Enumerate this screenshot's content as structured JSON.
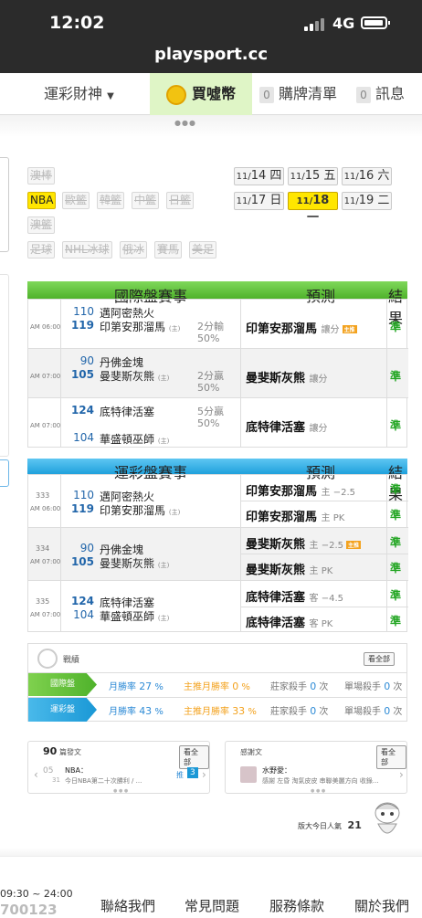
{
  "status": {
    "time": "12:02",
    "network": "4G"
  },
  "url": "playsport.cc",
  "nav": {
    "menu": "運彩財神",
    "buy": "買噓幣",
    "cart_count": "0",
    "cart": "購牌清單",
    "msg_count": "0",
    "msg": "訊息"
  },
  "sports": {
    "row1": [
      "澳棒"
    ],
    "row2": [
      "NBA",
      "歐籃",
      "韓籃",
      "中籃",
      "日籃"
    ],
    "row3": [
      "澳籃"
    ],
    "row4": [
      "足球",
      "NHL冰球",
      "俄冰",
      "賽馬",
      "美足"
    ]
  },
  "dates": [
    {
      "d": "11/",
      "n": "14",
      "w": "四"
    },
    {
      "d": "11/",
      "n": "15",
      "w": "五"
    },
    {
      "d": "11/",
      "n": "16",
      "w": "六"
    },
    {
      "d": "11/",
      "n": "17",
      "w": "日"
    },
    {
      "d": "11/",
      "n": "18",
      "w": "一"
    },
    {
      "d": "11/",
      "n": "19",
      "w": "二"
    }
  ],
  "intl": {
    "header": "國際盤賽事",
    "predict": "預測",
    "result": "結果",
    "games": [
      {
        "time": "AM 06:00",
        "n1": "110",
        "t1": "邁阿密熱火",
        "n2": "119",
        "t2": "印第安那溜馬",
        "home": "(主)",
        "line1": "2分輸",
        "line2": "50%",
        "pred": "印第安那溜馬",
        "ptype": "讓分",
        "res": "準"
      },
      {
        "time": "AM 07:00",
        "n1": "90",
        "t1": "丹佛金塊",
        "n2": "105",
        "t2": "曼斐斯灰熊",
        "home": "(主)",
        "line1": "2分贏",
        "line2": "50%",
        "pred": "曼斐斯灰熊",
        "ptype": "讓分",
        "res": "準"
      },
      {
        "time": "AM 07:00",
        "n1": "124",
        "t1": "底特律活塞",
        "n2": "104",
        "t2": "華盛頓巫師",
        "home": "(主)",
        "line1": "5分贏",
        "line2": "50%",
        "pred": "底特律活塞",
        "ptype": "讓分",
        "res": "準"
      }
    ]
  },
  "sportlottery": {
    "header": "運彩盤賽事",
    "predict": "預測",
    "result": "結果",
    "games": [
      {
        "no": "333",
        "time": "AM 06:00",
        "n1": "110",
        "t1": "邁阿密熱火",
        "n2": "119",
        "t2": "印第安那溜馬",
        "home": "(主)",
        "p1": "印第安那溜馬",
        "p1s": "主 −2.5",
        "p2": "印第安那溜馬",
        "p2s": "主 PK",
        "r1": "準",
        "r2": "準"
      },
      {
        "no": "334",
        "time": "AM 07:00",
        "n1": "90",
        "t1": "丹佛金塊",
        "n2": "105",
        "t2": "曼斐斯灰熊",
        "home": "(主)",
        "p1": "曼斐斯灰熊",
        "p1s": "主 −2.5",
        "p2": "曼斐斯灰熊",
        "p2s": "主 PK",
        "r1": "準",
        "r2": "準"
      },
      {
        "no": "335",
        "time": "AM 07:00",
        "n1": "124",
        "t1": "底特律活塞",
        "n2": "104",
        "t2": "華盛頓巫師",
        "home": "(主)",
        "p1": "底特律活塞",
        "p1s": "客 −4.5",
        "p2": "底特律活塞",
        "p2s": "客 PK",
        "r1": "準",
        "r2": "準"
      }
    ]
  },
  "record": {
    "title": "戰績",
    "all": "看全部",
    "rows": [
      {
        "label": "國際盤",
        "c1": "月勝率",
        "v1": "27",
        "c2": "主推月勝率",
        "v2": "0",
        "c3": "莊家殺手",
        "v3": "0",
        "c4": "單場殺手",
        "v4": "0"
      },
      {
        "label": "運彩盤",
        "c1": "月勝率",
        "v1": "43",
        "c2": "主推月勝率",
        "v2": "33",
        "c3": "莊家殺手",
        "v3": "0",
        "c4": "單場殺手",
        "v4": "0"
      }
    ],
    "pct": "%",
    "times": "次"
  },
  "posts": {
    "count": "90",
    "label": "篇發文",
    "all": "看全部",
    "date_m": "05",
    "date_d": "31",
    "title": "NBA：",
    "body": "今日NBA第二十次勝利 / ...",
    "push": "推",
    "push_n": "3"
  },
  "thanks": {
    "label": "感謝文",
    "all": "看全部",
    "user": "水野愛：",
    "body": "感謝 左昏 淘氣皮皮 串聯美麗方向 收錄..."
  },
  "popularity": {
    "label": "版大今日人氣",
    "value": "21"
  },
  "footer": {
    "hours": "09:30 ~ 24:00",
    "phone": "700123",
    "links": [
      "聯絡我們",
      "常見問題",
      "服務條款",
      "關於我們"
    ]
  }
}
